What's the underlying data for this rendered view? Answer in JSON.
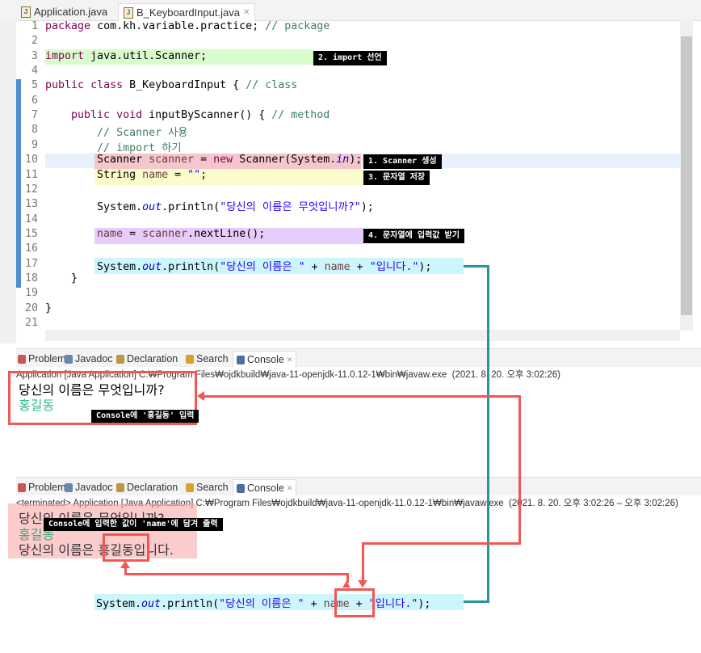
{
  "editor": {
    "tabs": [
      {
        "label": "Application.java"
      },
      {
        "label": "B_KeyboardInput.java",
        "active": true
      }
    ],
    "line_numbers": [
      "1",
      "2",
      "3",
      "4",
      "5",
      "6",
      "7",
      "8",
      "9",
      "10",
      "11",
      "12",
      "13",
      "14",
      "15",
      "16",
      "17",
      "18",
      "19",
      "20",
      "21"
    ],
    "lines": {
      "1": [
        [
          "k",
          "package"
        ],
        [
          "",
          "com.kh.variable.practice; "
        ],
        [
          "c",
          "// package"
        ]
      ],
      "3": [
        [
          "k",
          "import"
        ],
        [
          "",
          " java.util.Scanner;"
        ]
      ],
      "5": [
        [
          "k",
          "public"
        ],
        [
          "",
          " "
        ],
        [
          "k",
          "class"
        ],
        [
          "",
          " B_KeyboardInput { "
        ],
        [
          "c",
          "// class"
        ]
      ],
      "7": [
        [
          "",
          "    "
        ],
        [
          "k",
          "public"
        ],
        [
          "",
          " "
        ],
        [
          "k",
          "void"
        ],
        [
          "",
          " inputByScanner() { "
        ],
        [
          "c",
          "// method"
        ]
      ],
      "8": [
        [
          "",
          "        "
        ],
        [
          "c",
          "// Scanner 사용"
        ]
      ],
      "9": [
        [
          "",
          "        "
        ],
        [
          "c",
          "// import 하기"
        ]
      ],
      "10": [
        [
          "",
          "        Scanner "
        ],
        [
          "v",
          "scanner"
        ],
        [
          "",
          " = "
        ],
        [
          "k",
          "new"
        ],
        [
          "",
          " Scanner(System."
        ],
        [
          "f",
          "in"
        ],
        [
          "",
          ");"
        ]
      ],
      "11": [
        [
          "",
          "        String "
        ],
        [
          "v",
          "name"
        ],
        [
          "",
          " = "
        ],
        [
          "s",
          "\"\""
        ],
        [
          "",
          ";"
        ]
      ],
      "13": [
        [
          "",
          "        System."
        ],
        [
          "f",
          "out"
        ],
        [
          "",
          ".println("
        ],
        [
          "s",
          "\"당신의 이름은 무엇입니까?\""
        ],
        [
          "",
          ");"
        ]
      ],
      "15": [
        [
          "",
          "        "
        ],
        [
          "v",
          "name"
        ],
        [
          "",
          " = "
        ],
        [
          "v",
          "scanner"
        ],
        [
          "",
          ".nextLine();"
        ]
      ],
      "17": [
        [
          "",
          "        System."
        ],
        [
          "f",
          "out"
        ],
        [
          "",
          ".println("
        ],
        [
          "s",
          "\"당신의 이름은 \""
        ],
        [
          "",
          " + "
        ],
        [
          "v",
          "name"
        ],
        [
          "",
          " + "
        ],
        [
          "s",
          "\"입니다.\""
        ],
        [
          "",
          ");"
        ]
      ],
      "18": [
        [
          "",
          "    }"
        ]
      ],
      "20": [
        [
          "",
          "}"
        ]
      ]
    }
  },
  "annotations": {
    "import": "2. import 선언",
    "scanner": "1. Scanner 생성",
    "string": "3. 문자열 저장",
    "nextline": "4. 문자열에 입력값 받기",
    "console_input": "Console에 '홍길동' 입력",
    "console_output": "Console에 입력한 값이 'name'에 담겨 출력"
  },
  "panel_tabs": [
    {
      "label": "Problems",
      "icon": "problems-icon"
    },
    {
      "label": "Javadoc",
      "icon": "javadoc-icon"
    },
    {
      "label": "Declaration",
      "icon": "declaration-icon"
    },
    {
      "label": "Search",
      "icon": "search-icon"
    },
    {
      "label": "Console",
      "icon": "console-icon",
      "active": true
    }
  ],
  "console1": {
    "header": "Application [Java Application] C:₩Program Files₩ojdkbuild₩java-11-openjdk-11.0.12-1₩bin₩javaw.exe  (2021. 8. 20. 오후 3:02:26)",
    "prompt": "당신의 이름은 무엇입니까?",
    "input": "홍길동"
  },
  "console2": {
    "header": "<terminated> Application [Java Application] C:₩Program Files₩ojdkbuild₩java-11-openjdk-11.0.12-1₩bin₩javaw.exe  (2021. 8. 20. 오후 3:02:26 – 오후 3:02:26)",
    "prompt": "당신의 이름은 무엇입니까?",
    "input": "홍길동",
    "result_prefix": "당신의 이름은 ",
    "result_name": "홍길동",
    "result_suffix": "입니다."
  },
  "snippet": [
    [
      "",
      "System."
    ],
    [
      "f",
      "out"
    ],
    [
      "",
      ".println("
    ],
    [
      "s",
      "\"당신의 이름은 \""
    ],
    [
      "",
      " + "
    ],
    [
      "v",
      "name"
    ],
    [
      "",
      " + "
    ],
    [
      "s",
      "\"입니다.\""
    ],
    [
      "",
      ");"
    ]
  ],
  "colors": {
    "arrow_red": "#f25656",
    "connector_teal": "#21969e",
    "import_hl": "#d8fccc",
    "scanner_hl": "#f5c6cc",
    "string_hl": "#fafccc",
    "nextline_hl": "#e6ccfb",
    "println_hl": "#ccf6fc"
  }
}
